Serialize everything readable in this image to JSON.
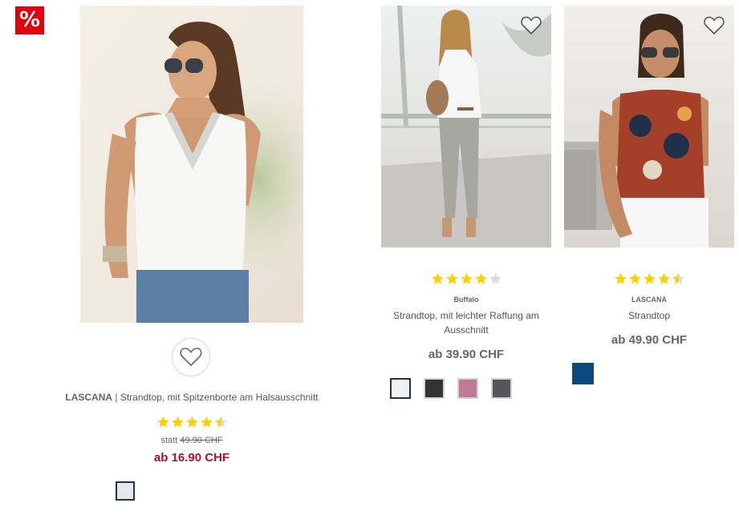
{
  "badge": {
    "text": "%",
    "color": "#e2000f"
  },
  "products": [
    {
      "brand": "LASCANA",
      "separator": " | ",
      "title": "Strandtop, mit Spitzenborte am Halsausschnitt",
      "rating": 4.5,
      "old_price_prefix": "statt",
      "old_price": "49.90 CHF",
      "price": "ab 16.90 CHF",
      "swatches": [
        {
          "color": "#e6e7ea",
          "selected": true
        }
      ]
    },
    {
      "brand": "Buffalo",
      "title_line1": "Strandtop, mit leichter Raffung am",
      "title_line2": "Ausschnitt",
      "rating": 4,
      "price": "ab 39.90 CHF",
      "swatches": [
        {
          "color": "#eef0f5",
          "selected": true
        },
        {
          "color": "#333333",
          "selected": false
        },
        {
          "color": "#c07a95",
          "selected": false
        },
        {
          "color": "#56565a",
          "selected": false
        }
      ]
    },
    {
      "brand": "LASCANA",
      "title": "Strandtop",
      "rating": 4.5,
      "price": "ab 49.90 CHF",
      "swatches": [
        {
          "color": "#0d4a7c",
          "selected": false
        }
      ]
    }
  ],
  "icons": {
    "heart": "heart-icon",
    "star": "star-icon"
  },
  "colors": {
    "star_fill": "#fcd000",
    "star_empty": "#dcdcdc",
    "sale_price": "#b0102a"
  }
}
